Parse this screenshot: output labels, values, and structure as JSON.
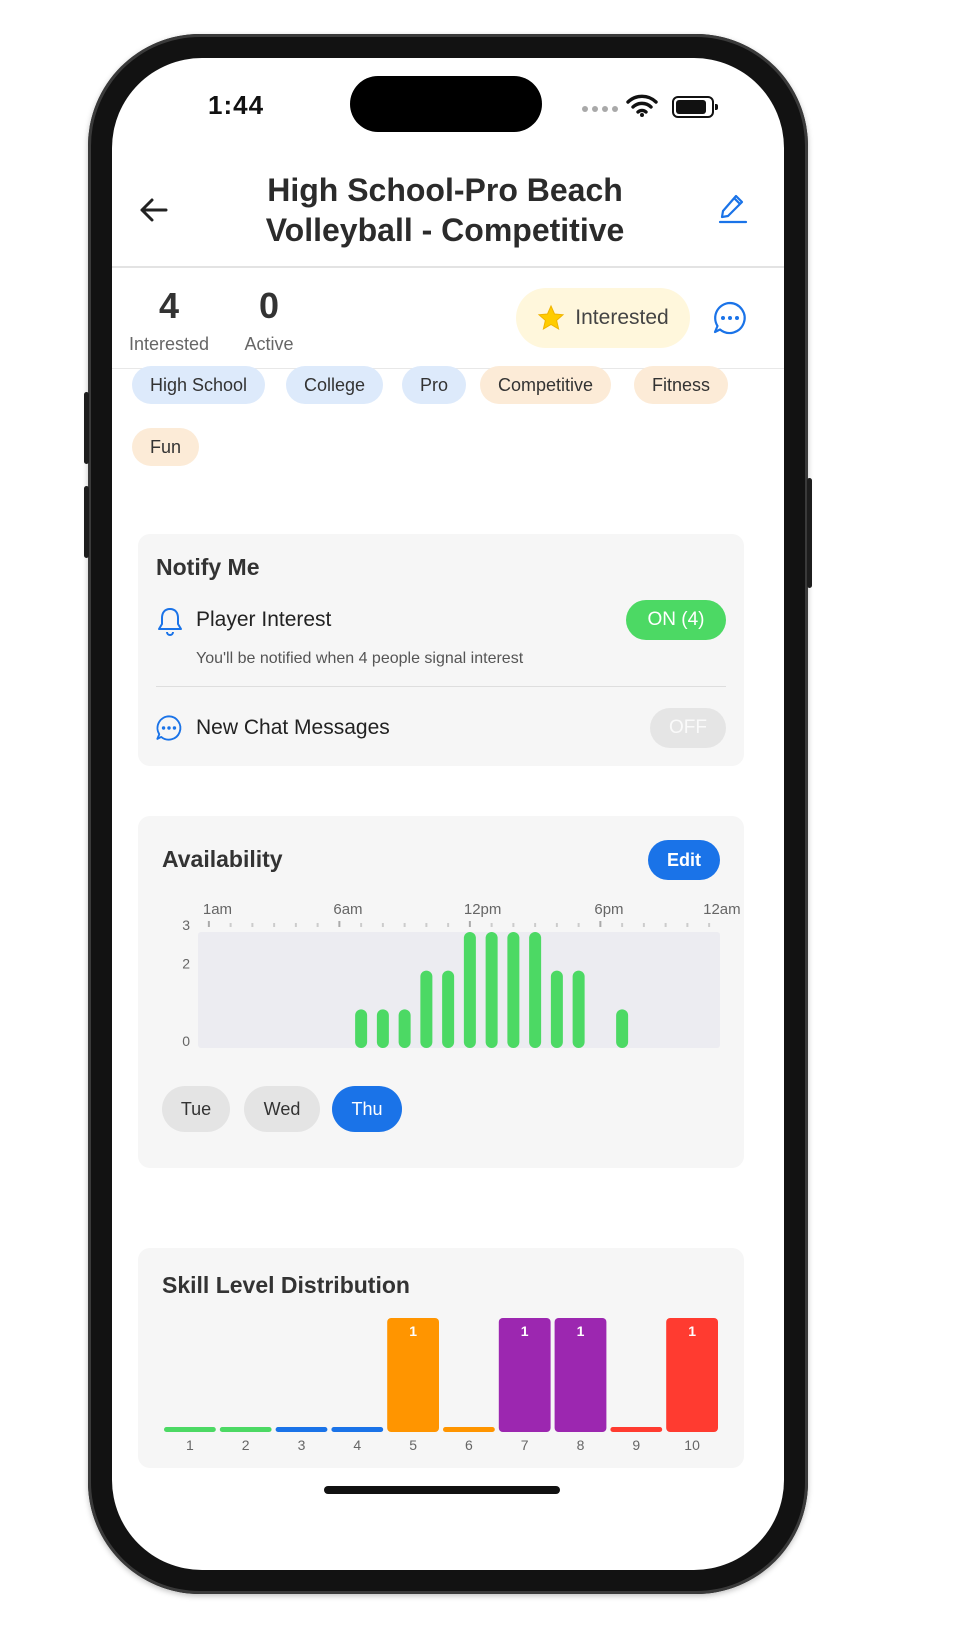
{
  "status": {
    "time": "1:44"
  },
  "header": {
    "title_line1": "High School-Pro Beach",
    "title_line2": "Volleyball - Competitive"
  },
  "stats": {
    "interested_count": "4",
    "interested_label": "Interested",
    "active_count": "0",
    "active_label": "Active",
    "interested_button": "Interested"
  },
  "tags": [
    {
      "label": "High School",
      "color": "blue"
    },
    {
      "label": "College",
      "color": "blue"
    },
    {
      "label": "Pro",
      "color": "blue"
    },
    {
      "label": "Competitive",
      "color": "peach"
    },
    {
      "label": "Fitness",
      "color": "peach"
    },
    {
      "label": "Fun",
      "color": "peach"
    }
  ],
  "notify": {
    "title": "Notify Me",
    "player_interest": {
      "label": "Player Interest",
      "toggle": "ON (4)",
      "subtitle": "You'll be notified when 4 people signal interest"
    },
    "chat_messages": {
      "label": "New Chat Messages",
      "toggle": "OFF"
    }
  },
  "availability": {
    "title": "Availability",
    "edit_label": "Edit",
    "days": [
      {
        "label": "Tue",
        "selected": false
      },
      {
        "label": "Wed",
        "selected": false
      },
      {
        "label": "Thu",
        "selected": true
      }
    ]
  },
  "skill": {
    "title": "Skill Level Distribution"
  },
  "colors": {
    "accent": "#1a73e8",
    "on_green": "#4cd964",
    "bar_green": "#4cd964",
    "orange": "#ff9500",
    "purple": "#9c27b0",
    "red": "#ff3b30",
    "blue": "#1a73e8"
  },
  "chart_data": [
    {
      "type": "bar",
      "title": "Availability",
      "x_tick_labels": [
        "1am",
        "6am",
        "12pm",
        "6pm",
        "12am"
      ],
      "y_tick_labels": [
        "0",
        "2",
        "3"
      ],
      "ylim": [
        0,
        3
      ],
      "hours": [
        7,
        8,
        9,
        10,
        11,
        12,
        13,
        14,
        15,
        16,
        17,
        19
      ],
      "values": [
        1,
        1,
        1,
        2,
        2,
        3,
        3,
        3,
        3,
        2,
        2,
        1
      ],
      "color": "#4cd964",
      "grid": false
    },
    {
      "type": "bar",
      "title": "Skill Level Distribution",
      "categories": [
        "1",
        "2",
        "3",
        "4",
        "5",
        "6",
        "7",
        "8",
        "9",
        "10"
      ],
      "values": [
        0,
        0,
        0,
        0,
        1,
        0,
        1,
        1,
        0,
        1
      ],
      "colors": [
        "#4cd964",
        "#4cd964",
        "#1a73e8",
        "#1a73e8",
        "#ff9500",
        "#ff9500",
        "#9c27b0",
        "#9c27b0",
        "#ff3b30",
        "#ff3b30"
      ],
      "ylim": [
        0,
        1
      ],
      "grid": false
    }
  ]
}
